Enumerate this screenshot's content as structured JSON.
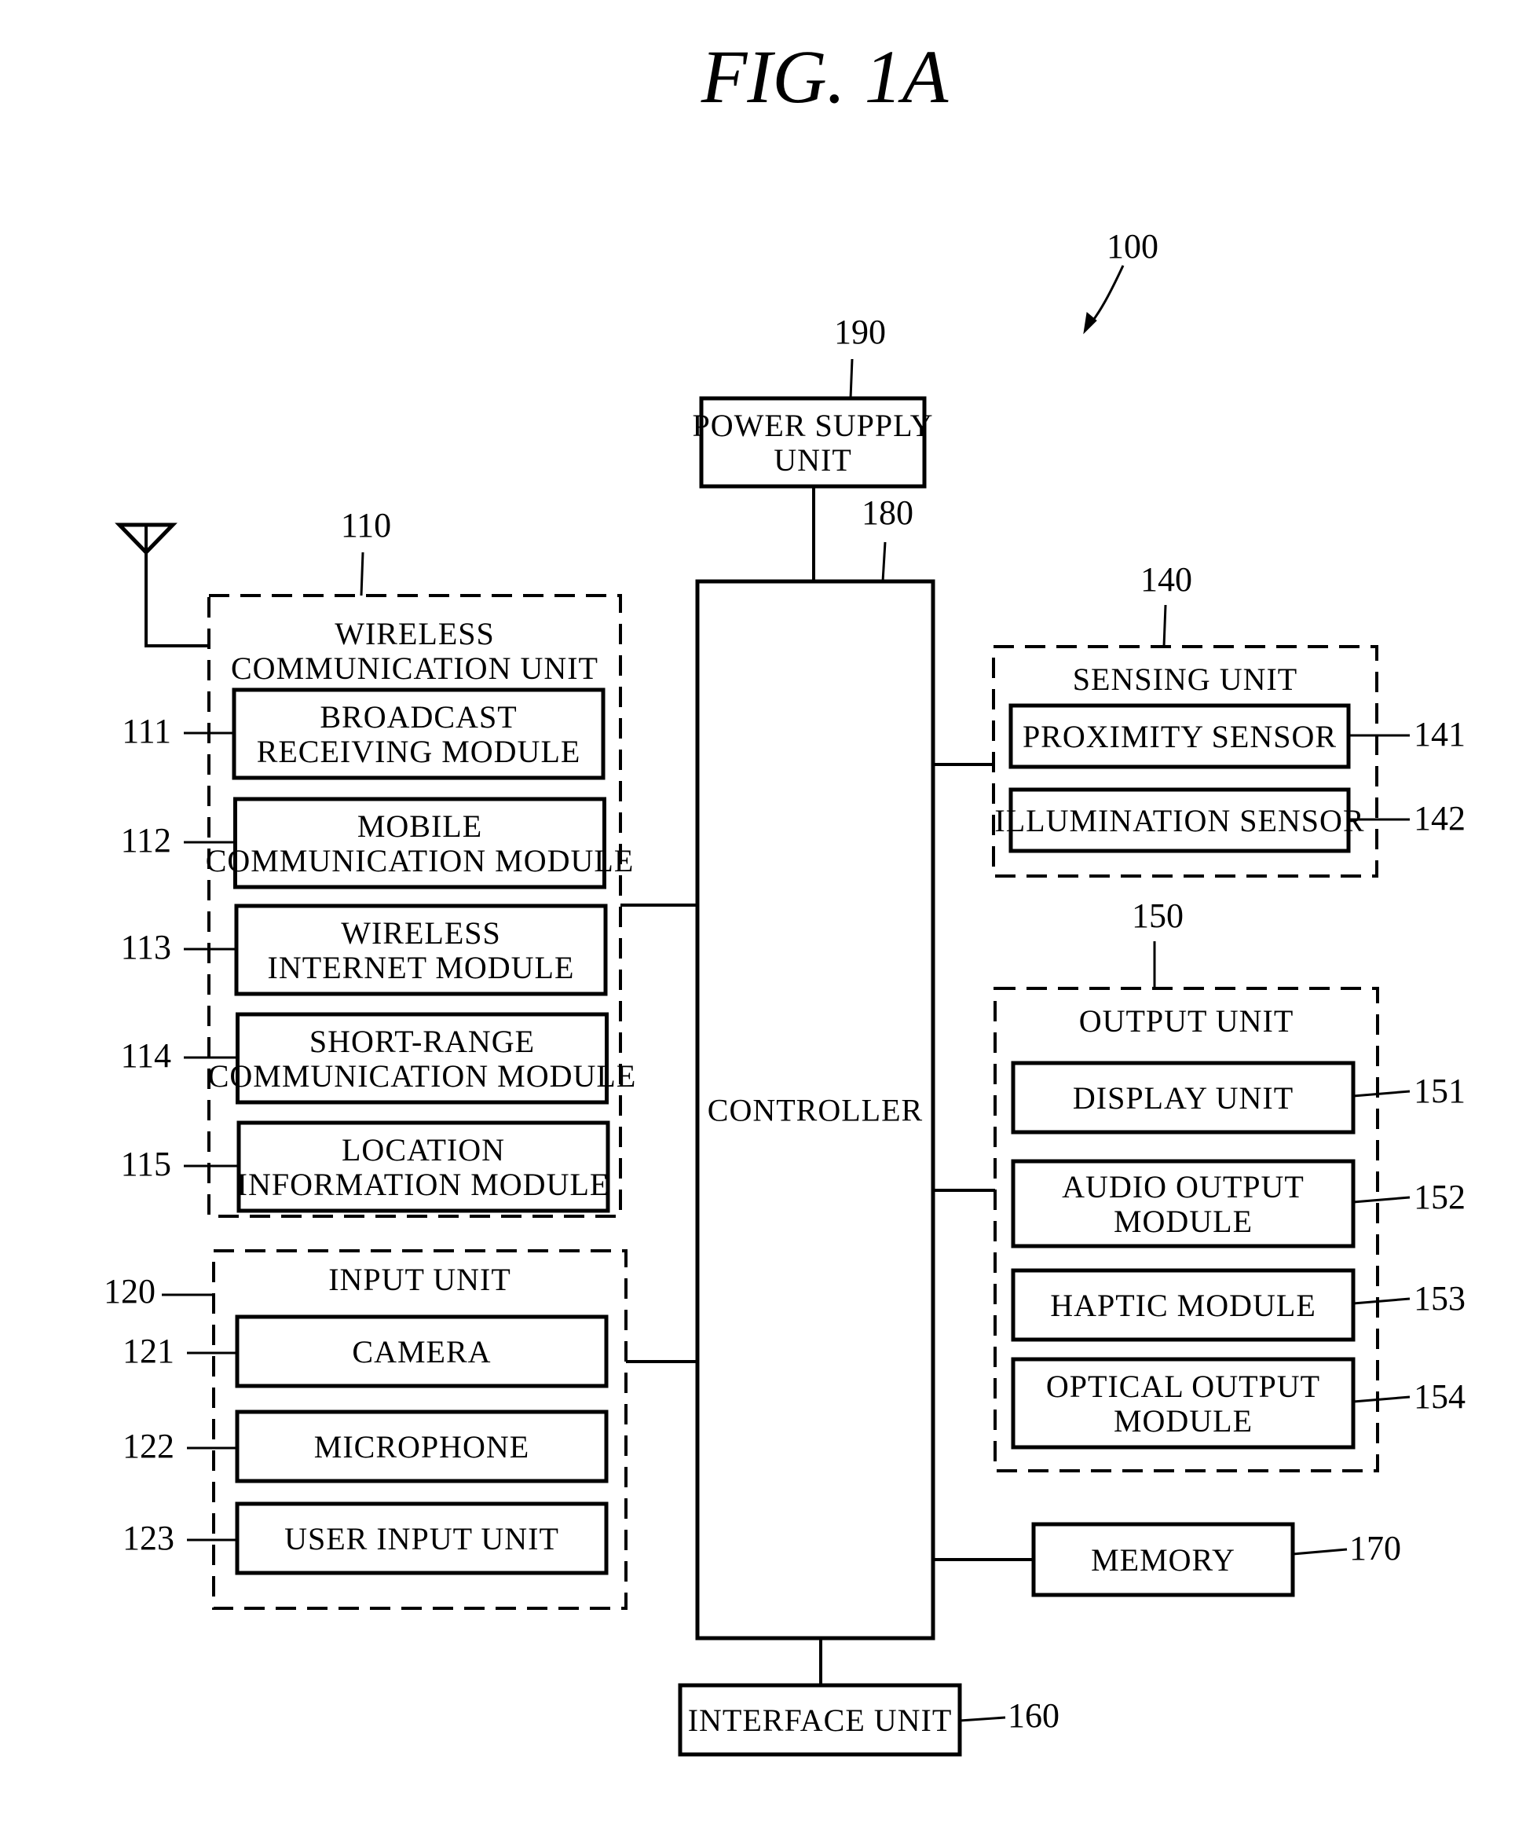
{
  "figure": {
    "title": "FIG. 1A",
    "device_ref": "100"
  },
  "blocks": {
    "power_supply": {
      "ref": "190",
      "lines": [
        "POWER SUPPLY",
        "UNIT"
      ]
    },
    "controller": {
      "ref": "180",
      "lines": [
        "CONTROLLER"
      ]
    },
    "wireless_unit": {
      "ref": "110",
      "lines": [
        "WIRELESS",
        "COMMUNICATION UNIT"
      ],
      "modules": [
        {
          "ref": "111",
          "lines": [
            "BROADCAST",
            "RECEIVING MODULE"
          ]
        },
        {
          "ref": "112",
          "lines": [
            "MOBILE",
            "COMMUNICATION MODULE"
          ]
        },
        {
          "ref": "113",
          "lines": [
            "WIRELESS",
            "INTERNET MODULE"
          ]
        },
        {
          "ref": "114",
          "lines": [
            "SHORT-RANGE",
            "COMMUNICATION MODULE"
          ]
        },
        {
          "ref": "115",
          "lines": [
            "LOCATION",
            "INFORMATION MODULE"
          ]
        }
      ]
    },
    "input_unit": {
      "ref": "120",
      "lines": [
        "INPUT UNIT"
      ],
      "modules": [
        {
          "ref": "121",
          "lines": [
            "CAMERA"
          ]
        },
        {
          "ref": "122",
          "lines": [
            "MICROPHONE"
          ]
        },
        {
          "ref": "123",
          "lines": [
            "USER INPUT UNIT"
          ]
        }
      ]
    },
    "sensing_unit": {
      "ref": "140",
      "lines": [
        "SENSING UNIT"
      ],
      "modules": [
        {
          "ref": "141",
          "lines": [
            "PROXIMITY SENSOR"
          ]
        },
        {
          "ref": "142",
          "lines": [
            "ILLUMINATION SENSOR"
          ]
        }
      ]
    },
    "output_unit": {
      "ref": "150",
      "lines": [
        "OUTPUT UNIT"
      ],
      "modules": [
        {
          "ref": "151",
          "lines": [
            "DISPLAY UNIT"
          ]
        },
        {
          "ref": "152",
          "lines": [
            "AUDIO OUTPUT",
            "MODULE"
          ]
        },
        {
          "ref": "153",
          "lines": [
            "HAPTIC MODULE"
          ]
        },
        {
          "ref": "154",
          "lines": [
            "OPTICAL OUTPUT",
            "MODULE"
          ]
        }
      ]
    },
    "memory": {
      "ref": "170",
      "lines": [
        "MEMORY"
      ]
    },
    "interface_unit": {
      "ref": "160",
      "lines": [
        "INTERFACE UNIT"
      ]
    }
  }
}
